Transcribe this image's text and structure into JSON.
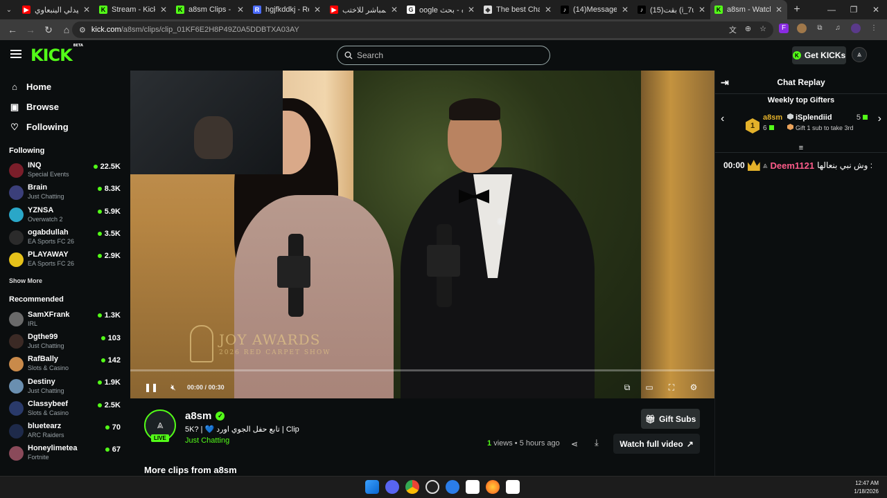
{
  "browser": {
    "tabs": [
      {
        "title": "ميدلي الينبعاوي",
        "fav_color": "#ff0000",
        "fav_glyph": "▶",
        "active": false
      },
      {
        "title": "Stream - Kick Dash",
        "fav_color": "#53fc18",
        "fav_glyph": "K",
        "active": false
      },
      {
        "title": "a8sm Clips - Watc",
        "fav_color": "#53fc18",
        "fav_glyph": "K",
        "active": false
      },
      {
        "title": "hgjfkddkj - Restre",
        "fav_color": "#4b6cff",
        "fav_glyph": "R",
        "active": false
      },
      {
        "title": "البث المباشر للاختب",
        "fav_color": "#ff0000",
        "fav_glyph": "▶",
        "active": false
      },
      {
        "title": "oogle عنزه - بحث",
        "fav_color": "#ffffff",
        "fav_glyph": "G",
        "active": false
      },
      {
        "title": "The best ChatBot",
        "fav_color": "#dddddd",
        "fav_glyph": "◆",
        "active": false
      },
      {
        "title": "(14)Messages | Tik",
        "fav_color": "#000000",
        "fav_glyph": "♪",
        "active": false
      },
      {
        "title": "(15)بقت (i_7ulx@)",
        "fav_color": "#000000",
        "fav_glyph": "♪",
        "active": false
      },
      {
        "title": "a8sm - Watch clip",
        "fav_color": "#53fc18",
        "fav_glyph": "K",
        "active": true
      }
    ],
    "url_host": "kick.com",
    "url_path": "/a8sm/clips/clip_01KF6E2H8P49Z0A5DDBTXA03AY"
  },
  "header": {
    "logo": "KICK",
    "logo_badge": "BETA",
    "search_placeholder": "Search",
    "get_kicks_label": "Get KICKs"
  },
  "sidebar": {
    "nav": [
      {
        "label": "Home",
        "icon": "home-icon",
        "glyph": "⌂"
      },
      {
        "label": "Browse",
        "icon": "browse-icon",
        "glyph": "▣"
      },
      {
        "label": "Following",
        "icon": "heart-icon",
        "glyph": "♡"
      }
    ],
    "following_title": "Following",
    "following": [
      {
        "name": "INQ",
        "category": "Special Events",
        "viewers": "22.5K",
        "color": "#7a1e2a"
      },
      {
        "name": "Brain",
        "category": "Just Chatting",
        "viewers": "8.3K",
        "color": "#3b3f7a"
      },
      {
        "name": "YZNSA",
        "category": "Overwatch 2",
        "viewers": "5.9K",
        "color": "#2aa7c8"
      },
      {
        "name": "ogabdullah",
        "category": "EA Sports FC 26",
        "viewers": "3.5K",
        "color": "#2b2b2b"
      },
      {
        "name": "PLAYAWAY",
        "category": "EA Sports FC 26",
        "viewers": "2.9K",
        "color": "#e6c21a"
      }
    ],
    "show_more": "Show More",
    "recommended_title": "Recommended",
    "recommended": [
      {
        "name": "SamXFrank",
        "category": "IRL",
        "viewers": "1.3K",
        "color": "#6a6a6a"
      },
      {
        "name": "Dgthe99",
        "category": "Just Chatting",
        "viewers": "103",
        "color": "#3b2a25"
      },
      {
        "name": "RafBally",
        "category": "Slots & Casino",
        "viewers": "142",
        "color": "#c98a4a"
      },
      {
        "name": "Destiny",
        "category": "Just Chatting",
        "viewers": "1.9K",
        "color": "#6a8fb0"
      },
      {
        "name": "Classybeef",
        "category": "Slots & Casino",
        "viewers": "2.5K",
        "color": "#2a3a6a"
      },
      {
        "name": "bluetearz",
        "category": "ARC Raiders",
        "viewers": "70",
        "color": "#1e2a4a"
      },
      {
        "name": "Honeylimetea",
        "category": "Fortnite",
        "viewers": "67",
        "color": "#8a4a5a"
      }
    ]
  },
  "video": {
    "watermark_title": "JOY AWARDS",
    "watermark_sub": "2026 RED CARPET SHOW",
    "time_current": "00:00",
    "time_sep": "/",
    "time_total": "00:30",
    "progress": 0.0
  },
  "clip_info": {
    "channel": "a8sm",
    "live_badge": "LIVE",
    "title": "5K? | 💙 تابع حفل الجوي اورد | Clip",
    "category": "Just Chatting",
    "views": "1",
    "views_label": "views",
    "time_ago": "5 hours ago",
    "gift_subs_label": "Gift Subs",
    "watch_full_label": "Watch full video",
    "more_clips_title": "More clips from a8sm"
  },
  "chat": {
    "title": "Chat Replay",
    "gifters_title": "Weekly top Gifters",
    "gifters": [
      {
        "rank": "1",
        "name": "a8sm",
        "count": "6"
      },
      {
        "name": "iSplendiid",
        "count": "5",
        "hint": "Gift 1 sub to take 3rd"
      }
    ],
    "messages": [
      {
        "time": "00:00",
        "user": "Deem1121",
        "text": "وش نبي بنعالها :"
      }
    ]
  },
  "taskbar": {
    "time": "12:47 AM",
    "date": "1/18/2026"
  },
  "colors": {
    "accent": "#53fc18",
    "background": "#0b0e0f",
    "gold": "#e3b12a",
    "chat_user": "#ff5c8a"
  }
}
